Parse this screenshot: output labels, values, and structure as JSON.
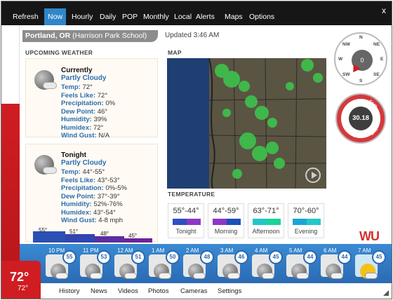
{
  "nav": {
    "tabs": [
      {
        "label": "Refresh"
      },
      {
        "label": "Now"
      },
      {
        "label": "Hourly"
      },
      {
        "label": "Daily"
      },
      {
        "label": "POP"
      },
      {
        "label": "Monthly"
      },
      {
        "label": "Local"
      },
      {
        "label": "Alerts"
      },
      {
        "label": "Maps"
      },
      {
        "label": "Options"
      }
    ],
    "close": "x"
  },
  "location": {
    "city": "Portland, OR",
    "station": "(Harrison Park School)"
  },
  "updated": "Updated 3:46 AM",
  "sections": {
    "upcoming": "UPCOMING WEATHER",
    "map": "MAP",
    "temperature": "TEMPERATURE"
  },
  "currently": {
    "title": "Currently",
    "condition": "Partly Cloudy",
    "rows": [
      {
        "k": "Temp:",
        "v": "72°"
      },
      {
        "k": "Feels Like:",
        "v": "72°"
      },
      {
        "k": "Precipitation:",
        "v": "0%"
      },
      {
        "k": "Dew Point:",
        "v": "46°"
      },
      {
        "k": "Humidity:",
        "v": "39%"
      },
      {
        "k": "Humidex:",
        "v": "72°"
      },
      {
        "k": "Wind Gust:",
        "v": "N/A"
      }
    ]
  },
  "tonight": {
    "title": "Tonight",
    "condition": "Partly Cloudy",
    "rows": [
      {
        "k": "Temp:",
        "v": "44°-55°"
      },
      {
        "k": "Feels Like:",
        "v": "43°-53°"
      },
      {
        "k": "Precipitation:",
        "v": "0%-5%"
      },
      {
        "k": "Dew Point:",
        "v": "37°-39°"
      },
      {
        "k": "Humidity:",
        "v": "52%-76%"
      },
      {
        "k": "Humidex:",
        "v": "43°-54°"
      },
      {
        "k": "Wind Gust:",
        "v": "4-8 mph"
      }
    ],
    "bars": [
      {
        "label": "55°",
        "color": "#2c4fb3"
      },
      {
        "label": "51°",
        "color": "#3245b0"
      },
      {
        "label": "48°",
        "color": "#5b2ea1"
      },
      {
        "label": "45°",
        "color": "#6c2399"
      }
    ]
  },
  "temperature_periods": [
    {
      "range": "55°-44°",
      "label": "Tonight",
      "color1": "#2e4fc1",
      "color2": "#8e37c6"
    },
    {
      "range": "44°-59°",
      "label": "Morning",
      "color1": "#8e37c6",
      "color2": "#1d4fb7"
    },
    {
      "range": "63°-71°",
      "label": "Afternoon",
      "color1": "#22c7c7",
      "color2": "#19d39a"
    },
    {
      "range": "70°-60°",
      "label": "Evening",
      "color1": "#1aa6d5",
      "color2": "#22c7c7"
    }
  ],
  "compass": {
    "value": "0",
    "dirs": [
      "N",
      "NE",
      "E",
      "SE",
      "S",
      "SW",
      "W",
      "NW"
    ]
  },
  "barometer": {
    "value": "30.18",
    "labels": [
      "RAIN",
      "FAIR",
      "STORM",
      "DRY"
    ]
  },
  "logo": {
    "text": "WU"
  },
  "hourly": [
    {
      "time": "10 PM",
      "temp": "55",
      "icon": "moon-cloud"
    },
    {
      "time": "11 PM",
      "temp": "53",
      "icon": "moon-cloud"
    },
    {
      "time": "12 AM",
      "temp": "51",
      "icon": "moon-cloud"
    },
    {
      "time": "1 AM",
      "temp": "50",
      "icon": "moon-cloud"
    },
    {
      "time": "2 AM",
      "temp": "48",
      "icon": "moon-cloud"
    },
    {
      "time": "3 AM",
      "temp": "46",
      "icon": "moon-cloud"
    },
    {
      "time": "4 AM",
      "temp": "45",
      "icon": "moon-cloud"
    },
    {
      "time": "5 AM",
      "temp": "44",
      "icon": "moon-cloud"
    },
    {
      "time": "6 AM",
      "temp": "44",
      "icon": "moon-cloud"
    },
    {
      "time": "7 AM",
      "temp": "45",
      "icon": "sun-cloud"
    }
  ],
  "bottom_links": [
    {
      "label": "History"
    },
    {
      "label": "News"
    },
    {
      "label": "Videos"
    },
    {
      "label": "Photos"
    },
    {
      "label": "Cameras"
    },
    {
      "label": "Settings"
    }
  ],
  "current_temp": {
    "big": "72°",
    "small": "72°"
  }
}
